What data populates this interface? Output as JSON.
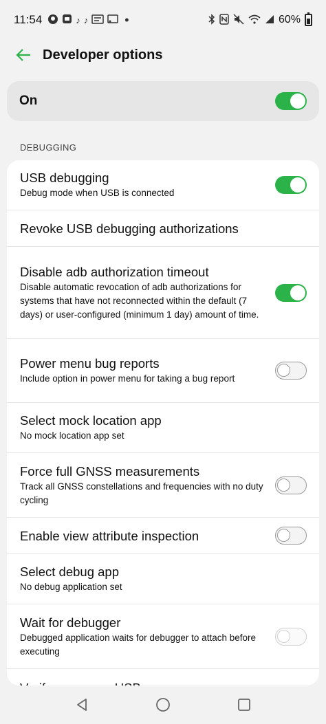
{
  "status_bar": {
    "time": "11:54",
    "left_icons": [
      "github-icon",
      "app-icon",
      "tiktok-icon",
      "tiktok-icon",
      "news-icon",
      "cast-icon"
    ],
    "dot": "•",
    "battery_percent": "60%",
    "battery_level": 0.6
  },
  "app_bar": {
    "title": "Developer options"
  },
  "master": {
    "label": "On",
    "enabled": true
  },
  "section": {
    "header": "DEBUGGING"
  },
  "settings": [
    {
      "title": "USB debugging",
      "summary": "Debug mode when USB is connected",
      "toggle": "on"
    },
    {
      "title": "Revoke USB debugging authorizations",
      "summary": "",
      "toggle": "none"
    },
    {
      "title": "Disable adb authorization timeout",
      "summary": "Disable automatic revocation of adb authorizations for systems that have not reconnected within the default (7 days) or user-configured (minimum 1 day) amount of time.",
      "toggle": "on"
    },
    {
      "title": "Power menu bug reports",
      "summary": "Include option in power menu for taking a bug report",
      "toggle": "off"
    },
    {
      "title": "Select mock location app",
      "summary": "No mock location app set",
      "toggle": "none"
    },
    {
      "title": "Force full GNSS measurements",
      "summary": "Track all GNSS constellations and frequencies with no duty cycling",
      "toggle": "off"
    },
    {
      "title": "Enable view attribute inspection",
      "summary": "",
      "toggle": "off"
    },
    {
      "title": "Select debug app",
      "summary": "No debug application set",
      "toggle": "none"
    },
    {
      "title": "Wait for debugger",
      "summary": "Debugged application waits for debugger to attach before executing",
      "toggle": "off-disabled"
    },
    {
      "title": "Verify apps over USB",
      "summary": "",
      "toggle": "none"
    }
  ],
  "colors": {
    "accent": "#2bb34a",
    "background": "#f2f2f2",
    "card": "#ffffff"
  }
}
